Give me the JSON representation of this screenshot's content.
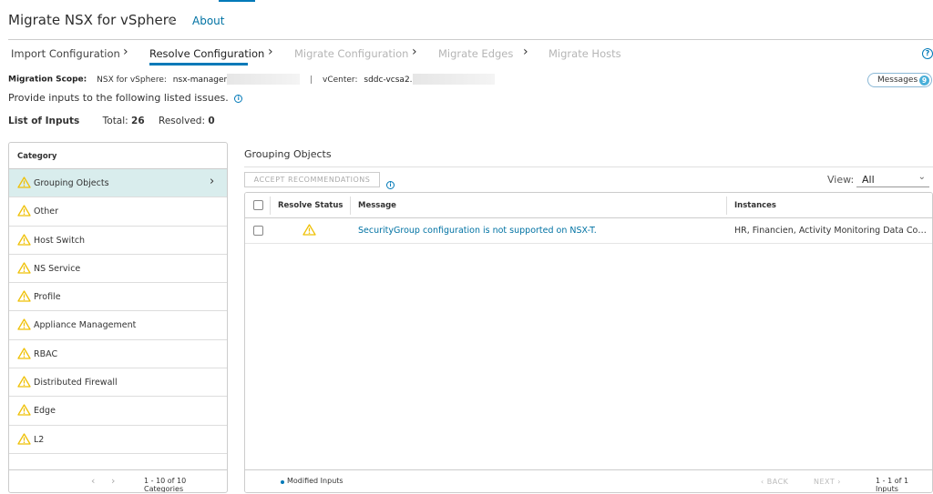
{
  "header": {
    "title": "Migrate NSX for vSphere",
    "about": "About"
  },
  "wizard": {
    "steps": [
      {
        "label": "Import Configuration",
        "state": "done"
      },
      {
        "label": "Resolve Configuration",
        "state": "active"
      },
      {
        "label": "Migrate Configuration",
        "state": "pending"
      },
      {
        "label": "Migrate Edges",
        "state": "pending"
      },
      {
        "label": "Migrate Hosts",
        "state": "pending"
      }
    ],
    "help_icon": "?"
  },
  "scope": {
    "label": "Migration Scope:",
    "nsx_label": "NSX for vSphere:",
    "nsx_value": "nsx-manager",
    "separator": "|",
    "vcenter_label": "vCenter:",
    "vcenter_value": "sddc-vcsa2."
  },
  "messages": {
    "label": "Messages",
    "count": "9"
  },
  "instructions": "Provide inputs to the following listed issues.",
  "info_icon": "i",
  "list_inputs": {
    "heading": "List of Inputs",
    "total_label": "Total:",
    "total": "26",
    "resolved_label": "Resolved:",
    "resolved": "0"
  },
  "categories": {
    "header": "Category",
    "items": [
      {
        "label": "Grouping Objects"
      },
      {
        "label": "Other"
      },
      {
        "label": "Host Switch"
      },
      {
        "label": "NS Service"
      },
      {
        "label": "Profile"
      },
      {
        "label": "Appliance Management"
      },
      {
        "label": "RBAC"
      },
      {
        "label": "Distributed Firewall"
      },
      {
        "label": "Edge"
      },
      {
        "label": "L2"
      }
    ],
    "selected_arrow": "›",
    "footer": {
      "prev": "‹",
      "next": "›",
      "count": "1 - 10 of 10 Categories"
    }
  },
  "detail": {
    "title": "Grouping Objects",
    "accept_button": "ACCEPT RECOMMENDATIONS",
    "view_label": "View:",
    "view_value": "All",
    "view_caret": "⌄",
    "columns": {
      "resolve_status": "Resolve Status",
      "message": "Message",
      "instances": "Instances"
    },
    "rows": [
      {
        "message": "SecurityGroup configuration is not supported on NSX-T.",
        "instances": "HR, Financien, Activity Monitoring Data Collection"
      }
    ],
    "footer": {
      "modified": "Modified Inputs",
      "back": "‹ BACK",
      "next": "NEXT ›",
      "count": "1 - 1 of 1 Inputs"
    }
  },
  "colors": {
    "accent": "#0079b8",
    "link": "#0072a3",
    "selected_row": "#d9eded",
    "warning": "#efc006"
  },
  "icons": {
    "warning": "warning-triangle-icon",
    "info": "info-circle-icon",
    "help": "help-circle-icon",
    "chevron": "chevron-right-icon"
  }
}
